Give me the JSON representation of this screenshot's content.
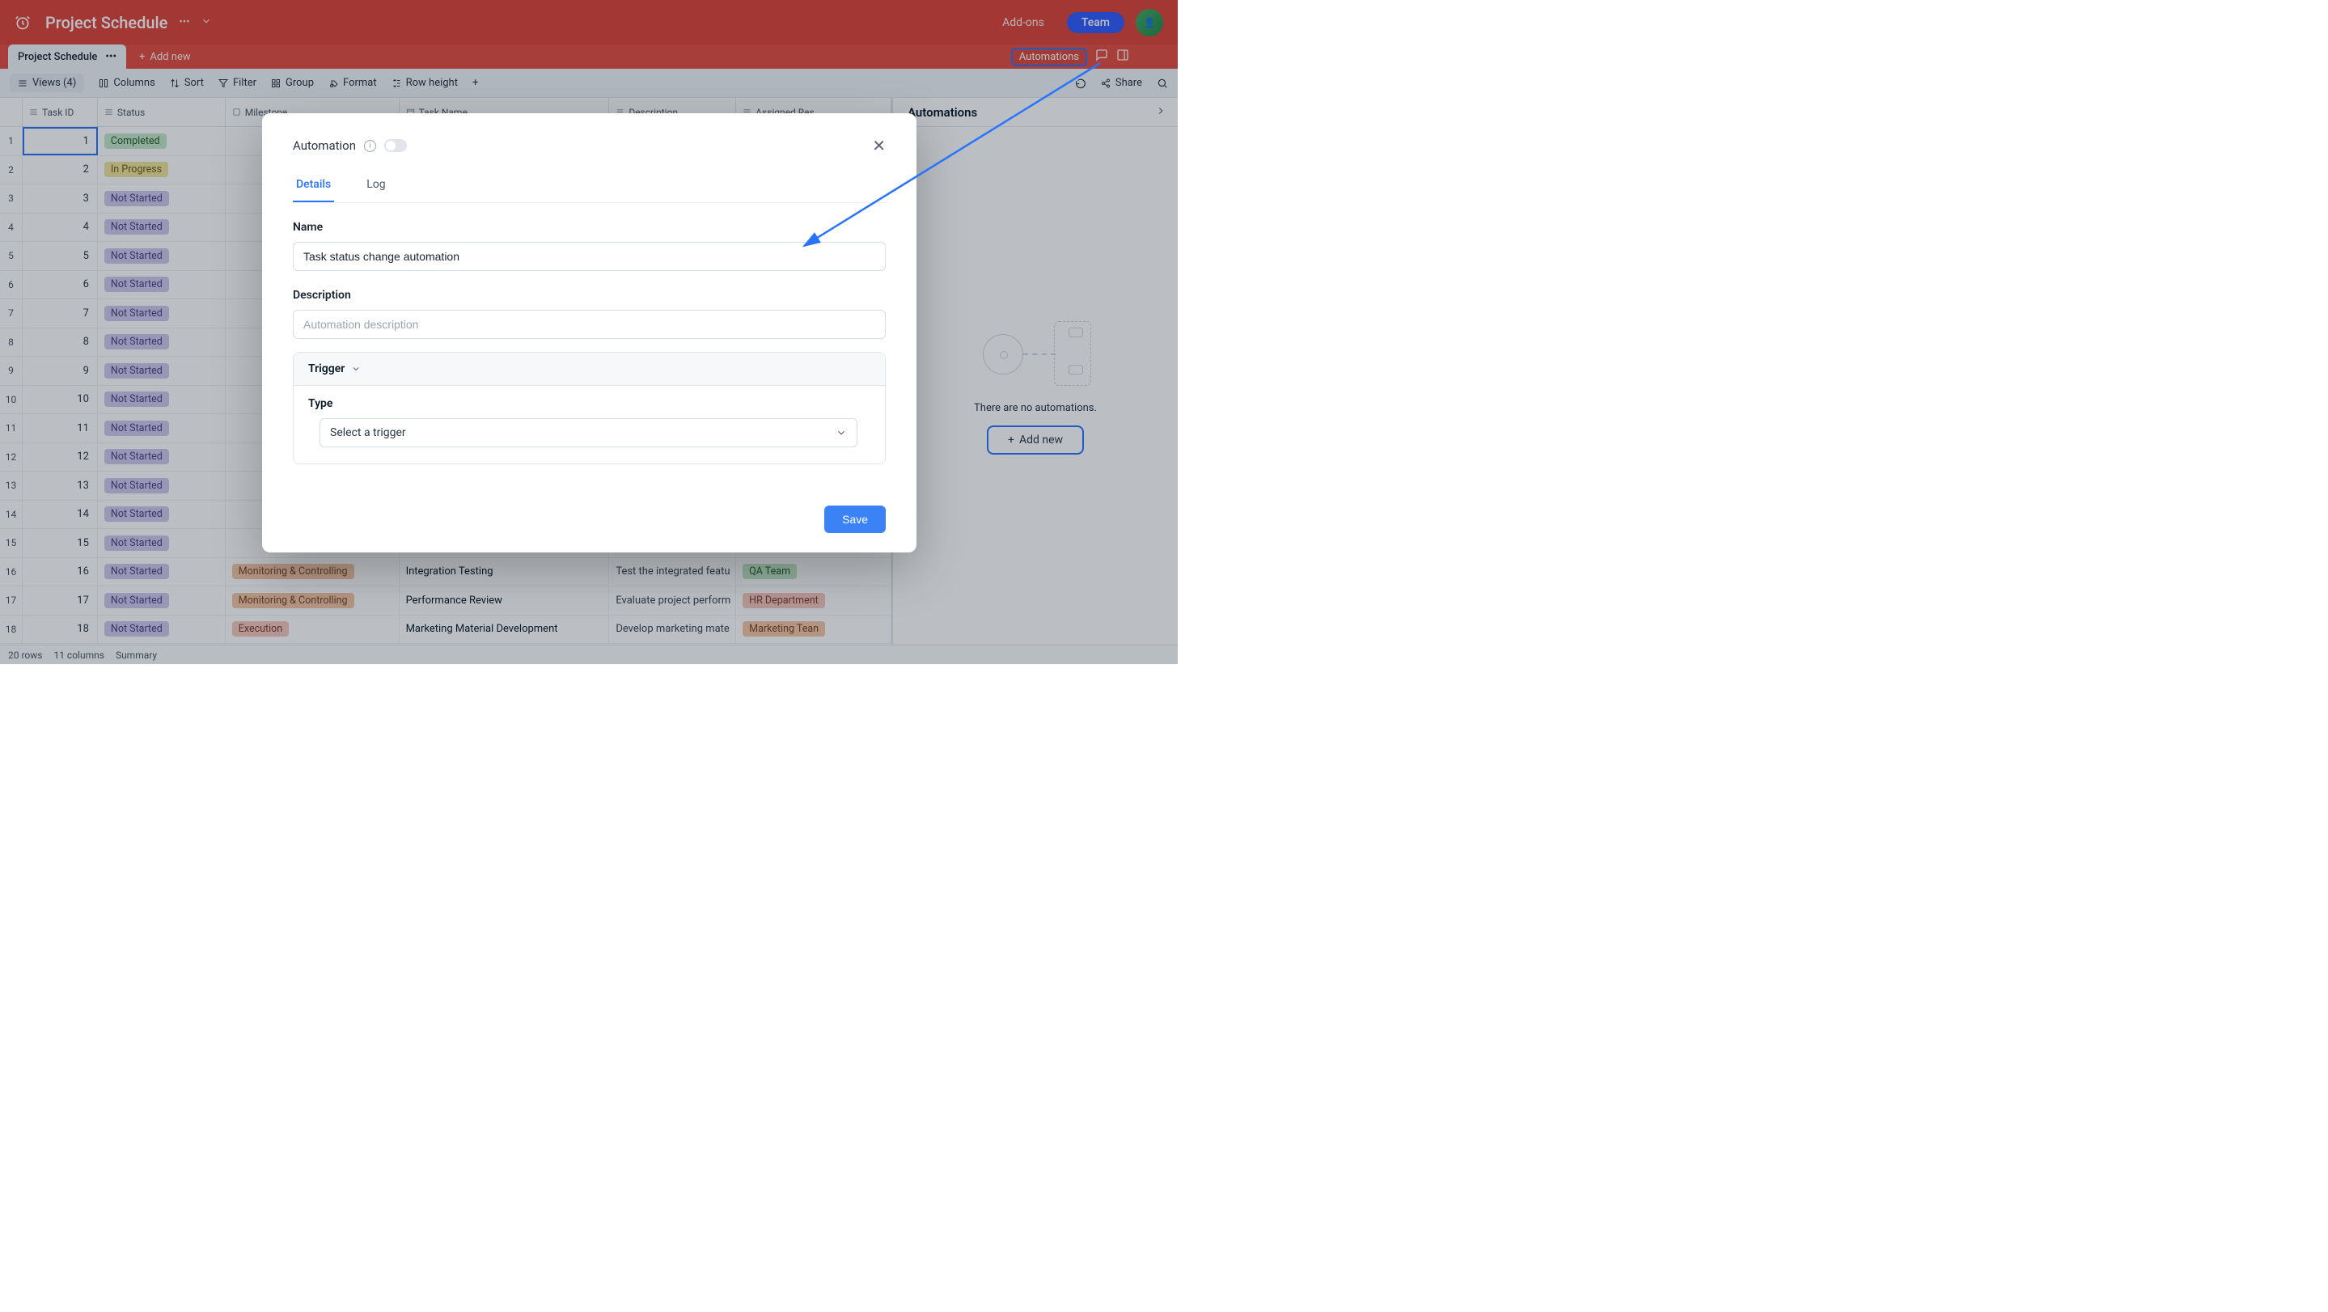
{
  "topbar": {
    "title": "Project Schedule",
    "addons": "Add-ons",
    "team": "Team"
  },
  "tabstrip": {
    "active_tab": "Project Schedule",
    "add_new": "Add new",
    "automations": "Automations"
  },
  "toolbar": {
    "views": "Views (4)",
    "columns": "Columns",
    "sort": "Sort",
    "filter": "Filter",
    "group": "Group",
    "format": "Format",
    "row_height": "Row height",
    "share": "Share"
  },
  "columns": {
    "task_id": "Task ID",
    "status": "Status",
    "milestone": "Milestone",
    "task_name": "Task Name",
    "description": "Description",
    "assigned": "Assigned Res"
  },
  "rows": [
    {
      "n": 1,
      "tid": "1",
      "status": "Completed",
      "scls": "completed"
    },
    {
      "n": 2,
      "tid": "2",
      "status": "In Progress",
      "scls": "inprog"
    },
    {
      "n": 3,
      "tid": "3",
      "status": "Not Started",
      "scls": "notstart"
    },
    {
      "n": 4,
      "tid": "4",
      "status": "Not Started",
      "scls": "notstart"
    },
    {
      "n": 5,
      "tid": "5",
      "status": "Not Started",
      "scls": "notstart"
    },
    {
      "n": 6,
      "tid": "6",
      "status": "Not Started",
      "scls": "notstart"
    },
    {
      "n": 7,
      "tid": "7",
      "status": "Not Started",
      "scls": "notstart"
    },
    {
      "n": 8,
      "tid": "8",
      "status": "Not Started",
      "scls": "notstart"
    },
    {
      "n": 9,
      "tid": "9",
      "status": "Not Started",
      "scls": "notstart"
    },
    {
      "n": 10,
      "tid": "10",
      "status": "Not Started",
      "scls": "notstart"
    },
    {
      "n": 11,
      "tid": "11",
      "status": "Not Started",
      "scls": "notstart"
    },
    {
      "n": 12,
      "tid": "12",
      "status": "Not Started",
      "scls": "notstart"
    },
    {
      "n": 13,
      "tid": "13",
      "status": "Not Started",
      "scls": "notstart"
    },
    {
      "n": 14,
      "tid": "14",
      "status": "Not Started",
      "scls": "notstart"
    },
    {
      "n": 15,
      "tid": "15",
      "status": "Not Started",
      "scls": "notstart"
    },
    {
      "n": 16,
      "tid": "16",
      "status": "Not Started",
      "scls": "notstart",
      "milestone": "Monitoring & Controlling",
      "mcls": "mon",
      "tname": "Integration Testing",
      "desc": "Test the integrated featu",
      "ares": "QA Team",
      "arcls": "team"
    },
    {
      "n": 17,
      "tid": "17",
      "status": "Not Started",
      "scls": "notstart",
      "milestone": "Monitoring & Controlling",
      "mcls": "mon",
      "tname": "Performance Review",
      "desc": "Evaluate project perform",
      "ares": "HR Department",
      "arcls": "dep"
    },
    {
      "n": 18,
      "tid": "18",
      "status": "Not Started",
      "scls": "notstart",
      "milestone": "Execution",
      "mcls": "exec",
      "tname": "Marketing Material Development",
      "desc": "Develop marketing mate",
      "ares": "Marketing Tean",
      "arcls": "dep2"
    }
  ],
  "sidepanel": {
    "title": "Automations",
    "empty": "There are no automations.",
    "add_new": "Add new"
  },
  "statusbar": {
    "rows": "20 rows",
    "cols": "11 columns",
    "summary": "Summary"
  },
  "modal": {
    "title": "Automation",
    "tabs": {
      "details": "Details",
      "log": "Log"
    },
    "name_label": "Name",
    "name_value": "Task status change automation",
    "desc_label": "Description",
    "desc_placeholder": "Automation description",
    "trigger_label": "Trigger",
    "type_label": "Type",
    "type_placeholder": "Select a trigger",
    "save": "Save"
  }
}
